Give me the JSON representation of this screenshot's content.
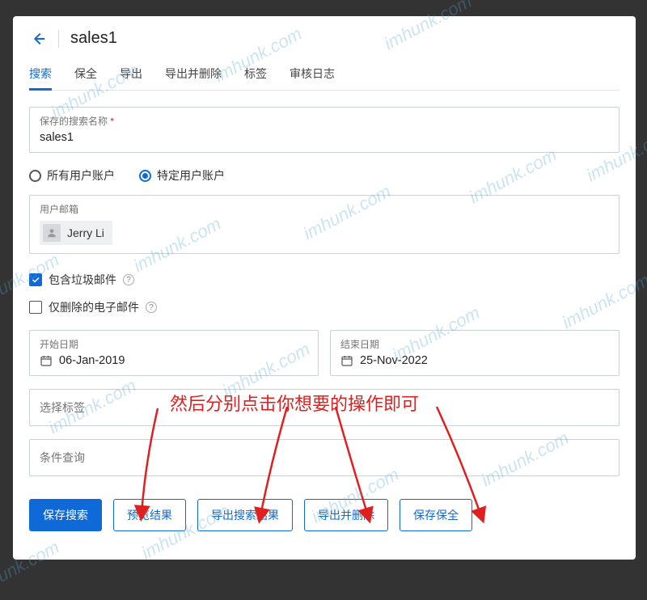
{
  "header": {
    "title": "sales1"
  },
  "tabs": {
    "search": "搜索",
    "preserve": "保全",
    "export": "导出",
    "export_delete": "导出并删除",
    "tags": "标签",
    "audit": "审核日志"
  },
  "form": {
    "savedName": {
      "label": "保存的搜索名称",
      "value": "sales1"
    },
    "radios": {
      "all": "所有用户账户",
      "specific": "特定用户账户"
    },
    "userEmail": {
      "label": "用户邮箱",
      "chip": "Jerry Li"
    },
    "includeSpam": "包含垃圾邮件",
    "deletedOnly": "仅删除的电子邮件",
    "startDate": {
      "label": "开始日期",
      "value": "06-Jan-2019"
    },
    "endDate": {
      "label": "结束日期",
      "value": "25-Nov-2022"
    },
    "selectTag": "选择标签",
    "conditionQuery": "条件查询"
  },
  "buttons": {
    "saveSearch": "保存搜索",
    "previewResults": "预览结果",
    "exportResults": "导出搜索结果",
    "exportDelete": "导出并删除",
    "savePreserve": "保存保全"
  },
  "annotation": "然后分别点击你想要的操作即可",
  "helpGlyph": "?",
  "watermark": "imhunk.com"
}
